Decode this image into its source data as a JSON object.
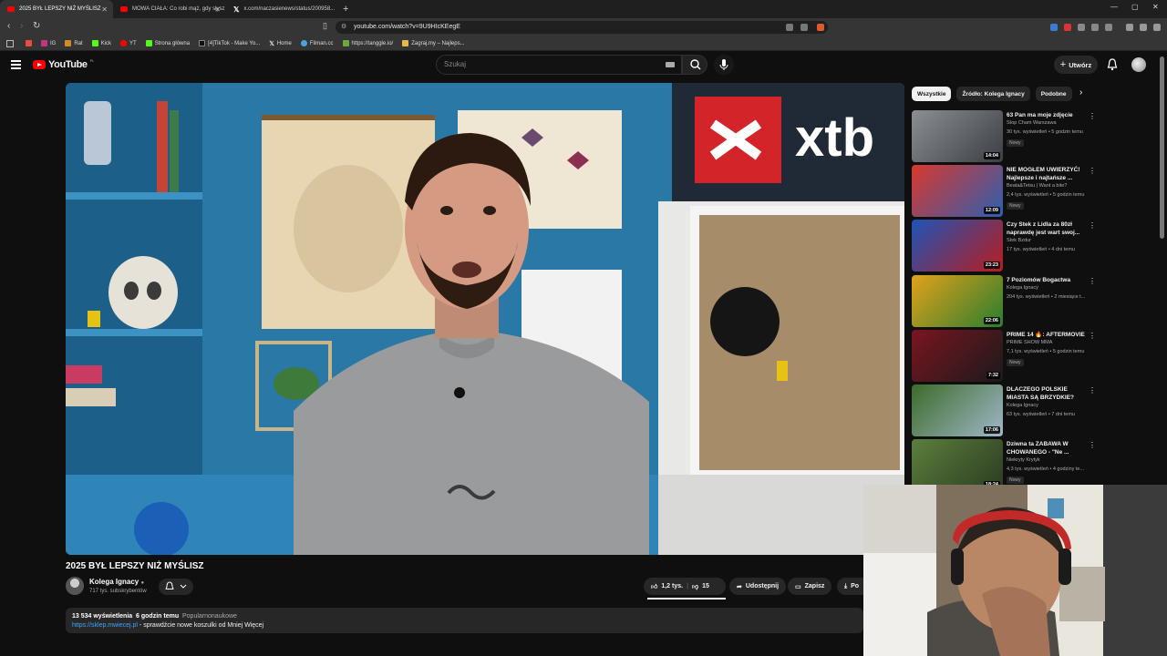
{
  "browser": {
    "tabs": [
      {
        "title": "2025 BYŁ LEPSZY NIŻ MYŚLISZ",
        "active": true
      },
      {
        "title": "MOWA CIAŁA: Co robi mąż, gdy słysz",
        "active": false
      },
      {
        "title": "x.com/naczasienews/status/200958...",
        "active": false
      }
    ],
    "url": "youtube.com/watch?v=9U9HIcKEegE",
    "bookmarks": [
      "IG",
      "Rat",
      "Kick",
      "YT",
      "Strona główna",
      "[4]TikTok - Make Yo...",
      "Home",
      "Filman.cc",
      "https://tanggle.io/",
      "Zagraj.my – Najleps..."
    ]
  },
  "youtube": {
    "logo_text": "YouTube",
    "logo_country": "PL",
    "search_placeholder": "Szukaj",
    "create_label": "Utwórz"
  },
  "video": {
    "title": "2025 BYŁ LEPSZY NIŻ MYŚLISZ",
    "overlay_brand": "xtb",
    "channel": "Kolega Ignacy",
    "subscribers": "717 tys. subskrybentów",
    "likes": "1,2 tys.",
    "dislikes": "15",
    "share_label": "Udostępnij",
    "save_label": "Zapisz",
    "download_label": "Po",
    "views": "13 534 wyświetlenia",
    "posted": "6 godzin temu",
    "category": "Popularnonaukowe",
    "desc_link": "https://sklep.mwiecej.pl",
    "desc_text": " - sprawdźcie nowe koszulki od Mniej Więcej"
  },
  "sidebar": {
    "chips": [
      "Wszystkie",
      "Źródło: Kolega Ignacy",
      "Podobne"
    ],
    "items": [
      {
        "title": "63 Pan ma moje zdjęcie",
        "channel": "Stop Cham Warszawa",
        "views": "30 tys. wyświetleń • 5 godzin temu",
        "badge": "Nowy",
        "duration": "14:04",
        "c1": "#8b8f94",
        "c2": "#3b3e42"
      },
      {
        "title": "NIE MOGŁEM UWIERZYĆ! Najlepsze i najtańsze ...",
        "channel": "Beata&Tetsu | Want a bite?",
        "views": "2,4 tys. wyświetleń • 5 godzin temu",
        "badge": "Nowy",
        "duration": "12:09",
        "c1": "#d9382d",
        "c2": "#2d5fb0"
      },
      {
        "title": "Czy Stek z Lidla za 80zł naprawdę jest wart swoj...",
        "channel": "Stek Bzdur",
        "views": "17 tys. wyświetleń • 4 dni temu",
        "badge": "",
        "duration": "23:23",
        "c1": "#1d54b8",
        "c2": "#b81d1d"
      },
      {
        "title": "7 Poziomów Bogactwa",
        "channel": "Kolega Ignacy",
        "views": "204 tys. wyświetleń • 2 miesiące t...",
        "badge": "",
        "duration": "22:06",
        "c1": "#e2a21b",
        "c2": "#2a7d2e"
      },
      {
        "title": "PRIME 14 🔥: AFTERMOVIE",
        "channel": "PRIME SHOW MMA",
        "views": "7,1 tys. wyświetleń • 5 godzin temu",
        "badge": "Nowy",
        "duration": "7:32",
        "c1": "#7a1520",
        "c2": "#1a1a1a"
      },
      {
        "title": "DLACZEGO POLSKIE MIASTA SĄ BRZYDKIE?",
        "channel": "Kolega Ignacy",
        "views": "63 tys. wyświetleń • 7 dni temu",
        "badge": "",
        "duration": "17:06",
        "c1": "#3d6b2a",
        "c2": "#9fb7c9"
      },
      {
        "title": "Dziwna ta ZABAWA W CHOWANEGO - \"Ne ...",
        "channel": "Niekryty Krytyk",
        "views": "4,3 tys. wyświetleń • 4 godziny te...",
        "badge": "Nowy",
        "duration": "18:24",
        "c1": "#5b7f3c",
        "c2": "#2c3b22"
      }
    ]
  },
  "colors": {
    "accent": "#ff0000",
    "link": "#3ea6ff",
    "bg": "#0f0f0f",
    "surface": "#272727"
  }
}
